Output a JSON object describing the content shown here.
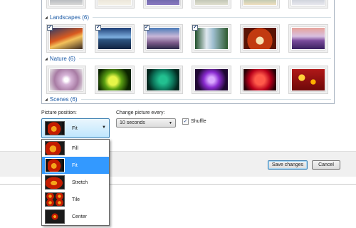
{
  "gallery": {
    "categories": [
      {
        "label": "Landscapes (6)"
      },
      {
        "label": "Nature (6)"
      },
      {
        "label": "Scenes (6)"
      }
    ]
  },
  "controls": {
    "picture_position_label": "Picture position:",
    "picture_position_value": "Fit",
    "change_every_label": "Change picture every:",
    "change_every_value": "10 seconds",
    "shuffle_label": "Shuffle"
  },
  "dropdown": {
    "options": [
      {
        "label": "Fill"
      },
      {
        "label": "Fit"
      },
      {
        "label": "Stretch"
      },
      {
        "label": "Tile"
      },
      {
        "label": "Center"
      }
    ],
    "selected": "Fit"
  },
  "footer": {
    "save_label": "Save changes",
    "cancel_label": "Cancel"
  },
  "icons": {
    "dropdown_arrow": "chevron-down-icon",
    "check": "checkmark-icon"
  },
  "colors": {
    "category_text": "#1b5aa6",
    "selection": "#3399ff"
  }
}
